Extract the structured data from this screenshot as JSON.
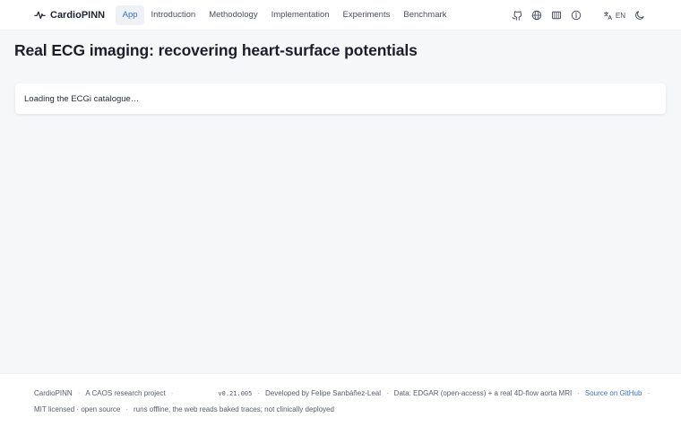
{
  "header": {
    "brand": "CardioPINN",
    "nav": [
      "App",
      "Introduction",
      "Methodology",
      "Implementation",
      "Experiments",
      "Benchmark"
    ],
    "active_nav": "App",
    "lang": "EN",
    "accent_color": "#3b6fd1"
  },
  "main": {
    "title": "Real ECG imaging: recovering heart-surface potentials",
    "loading_text": "Loading the ECGi catalogue…"
  },
  "footer": {
    "project": "CardioPINN",
    "research": "A CAOS research project",
    "version": "v0.21.005",
    "developer": "Developed by Felipe Sanbáñez-Leal",
    "data": "Data: EDGAR (open-access) + a real 4D-flow aorta MRI",
    "source_link": "Source on GitHub",
    "license": "MIT licensed · open source",
    "offline": "runs offline, the web reads baked traces; not clinically deployed"
  }
}
